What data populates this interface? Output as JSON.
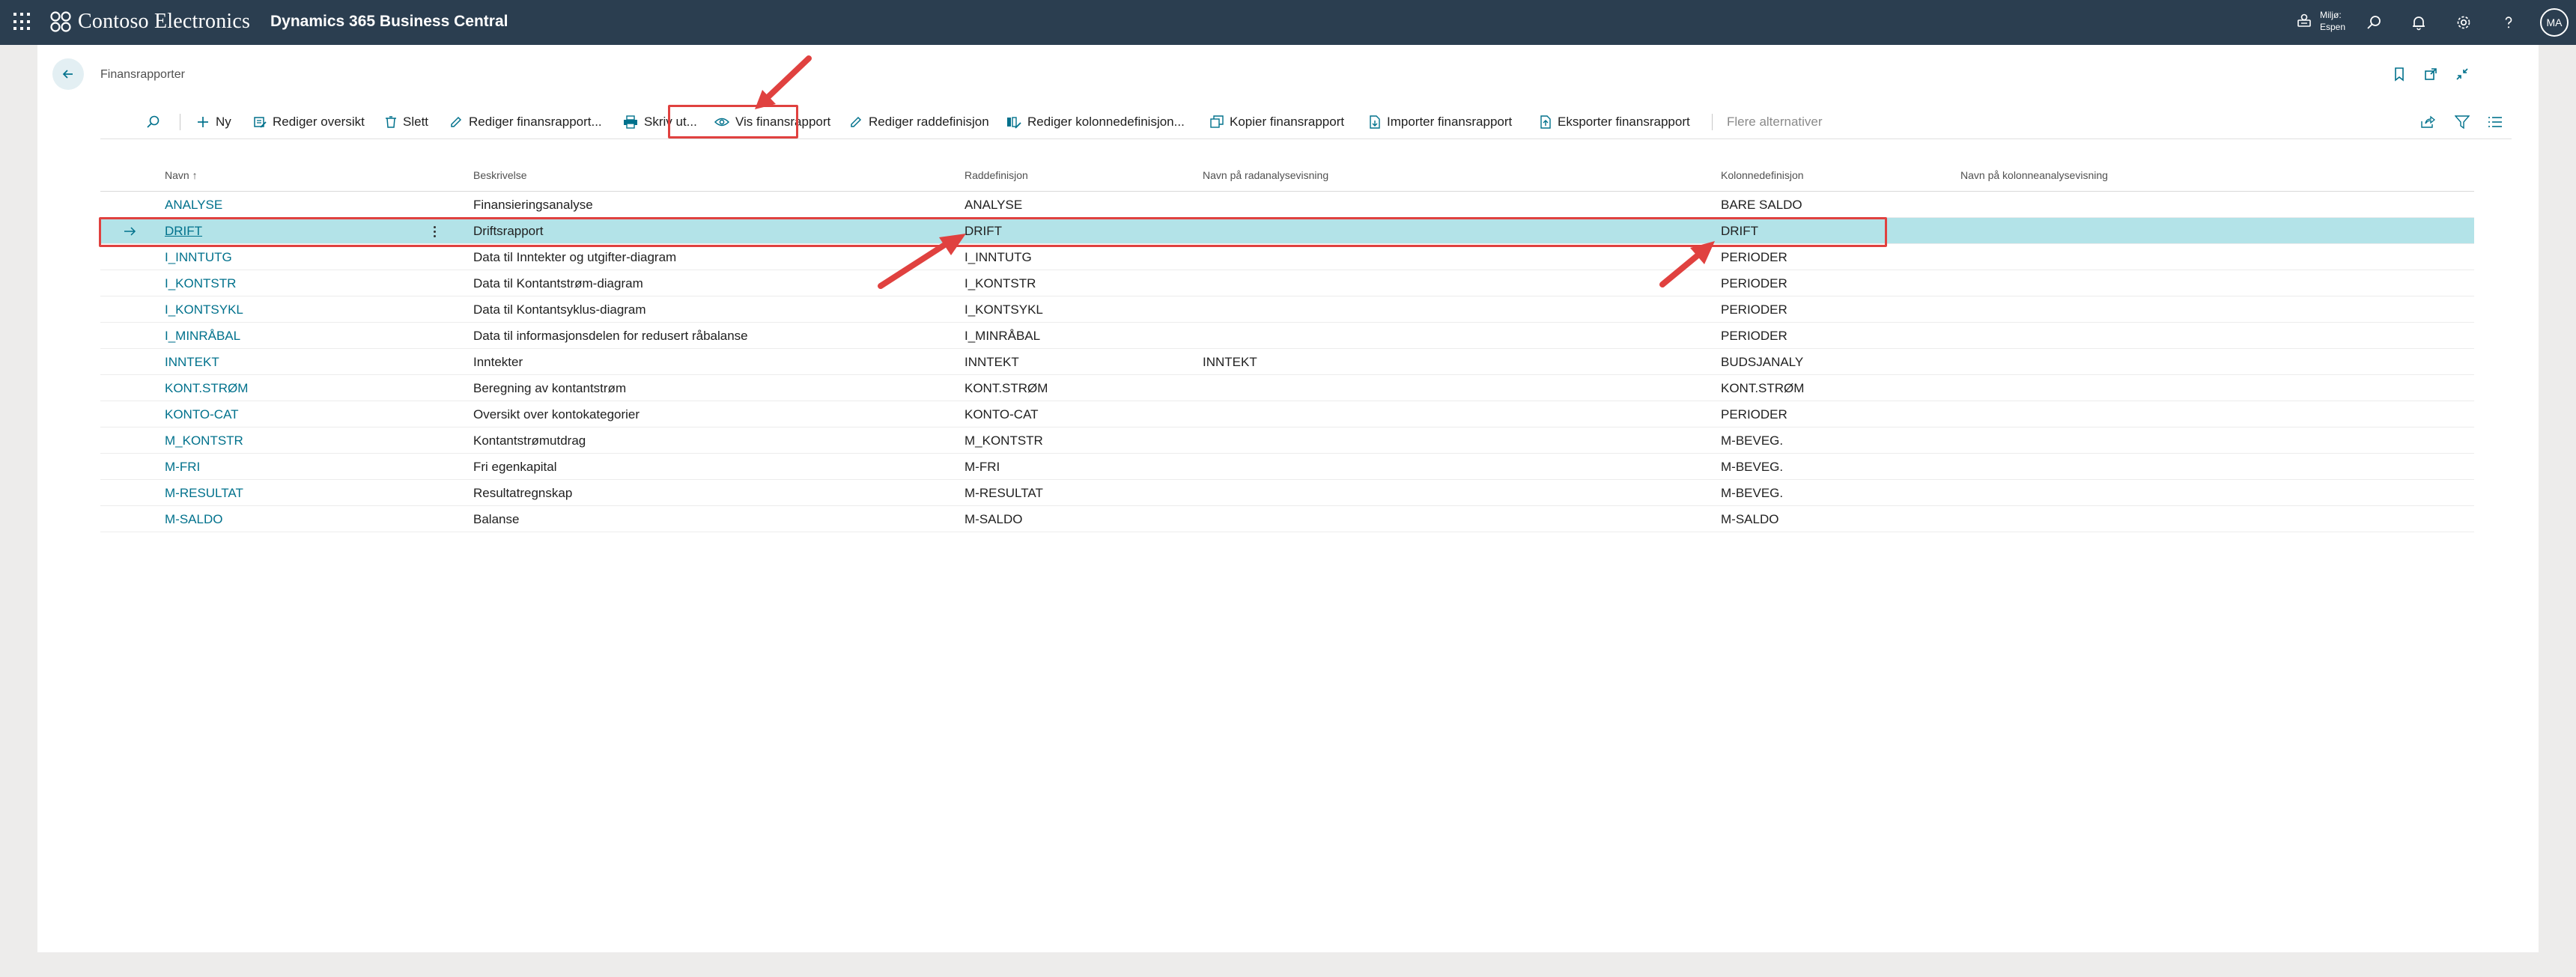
{
  "appbar": {
    "brand": "Contoso Electronics",
    "product": "Dynamics 365 Business Central",
    "environment_label": "Miljø:",
    "environment_name": "Espen",
    "avatar_initials": "MA"
  },
  "page": {
    "title": "Finansrapporter"
  },
  "actions": {
    "new": "Ny",
    "edit_list": "Rediger oversikt",
    "delete": "Slett",
    "edit_report": "Rediger finansrapport...",
    "print": "Skriv ut...",
    "view_report": "Vis finansrapport",
    "edit_row_def": "Rediger raddefinisjon",
    "edit_col_def": "Rediger kolonnedefinisjon...",
    "copy_report": "Kopier finansrapport",
    "import_report": "Importer finansrapport",
    "export_report": "Eksporter finansrapport",
    "more": "Flere alternativer"
  },
  "columns": {
    "name": "Navn",
    "description": "Beskrivelse",
    "row_def": "Raddefinisjon",
    "row_analysis_view": "Navn på radanalysevisning",
    "col_def": "Kolonnedefinisjon",
    "col_analysis_view": "Navn på kolonneanalysevisning"
  },
  "rows": [
    {
      "name": "ANALYSE",
      "description": "Finansieringsanalyse",
      "row_def": "ANALYSE",
      "row_view": "",
      "col_def": "BARE SALDO",
      "col_view": ""
    },
    {
      "name": "DRIFT",
      "description": "Driftsrapport",
      "row_def": "DRIFT",
      "row_view": "",
      "col_def": "DRIFT",
      "col_view": ""
    },
    {
      "name": "I_INNTUTG",
      "description": "Data til Inntekter og utgifter-diagram",
      "row_def": "I_INNTUTG",
      "row_view": "",
      "col_def": "PERIODER",
      "col_view": ""
    },
    {
      "name": "I_KONTSTR",
      "description": "Data til Kontantstrøm-diagram",
      "row_def": "I_KONTSTR",
      "row_view": "",
      "col_def": "PERIODER",
      "col_view": ""
    },
    {
      "name": "I_KONTSYKL",
      "description": "Data til Kontantsyklus-diagram",
      "row_def": "I_KONTSYKL",
      "row_view": "",
      "col_def": "PERIODER",
      "col_view": ""
    },
    {
      "name": "I_MINRÅBAL",
      "description": "Data til informasjonsdelen for redusert råbalanse",
      "row_def": "I_MINRÅBAL",
      "row_view": "",
      "col_def": "PERIODER",
      "col_view": ""
    },
    {
      "name": "INNTEKT",
      "description": "Inntekter",
      "row_def": "INNTEKT",
      "row_view": "INNTEKT",
      "col_def": "BUDSJANALY",
      "col_view": ""
    },
    {
      "name": "KONT.STRØM",
      "description": "Beregning av kontantstrøm",
      "row_def": "KONT.STRØM",
      "row_view": "",
      "col_def": "KONT.STRØM",
      "col_view": ""
    },
    {
      "name": "KONTO-CAT",
      "description": "Oversikt over kontokategorier",
      "row_def": "KONTO-CAT",
      "row_view": "",
      "col_def": "PERIODER",
      "col_view": ""
    },
    {
      "name": "M_KONTSTR",
      "description": "Kontantstrømutdrag",
      "row_def": "M_KONTSTR",
      "row_view": "",
      "col_def": "M-BEVEG.",
      "col_view": ""
    },
    {
      "name": "M-FRI",
      "description": "Fri egenkapital",
      "row_def": "M-FRI",
      "row_view": "",
      "col_def": "M-BEVEG.",
      "col_view": ""
    },
    {
      "name": "M-RESULTAT",
      "description": "Resultatregnskap",
      "row_def": "M-RESULTAT",
      "row_view": "",
      "col_def": "M-BEVEG.",
      "col_view": ""
    },
    {
      "name": "M-SALDO",
      "description": "Balanse",
      "row_def": "M-SALDO",
      "row_view": "",
      "col_def": "M-SALDO",
      "col_view": ""
    }
  ],
  "selected_row": 1,
  "colors": {
    "appbar": "#2b3e50",
    "accent": "#00718c",
    "selected_row": "#b3e3e8",
    "annotation": "#e0413f"
  },
  "icons": [
    "waffle-icon",
    "contoso-logo-icon",
    "environment-icon",
    "search-icon",
    "bell-icon",
    "gear-icon",
    "help-icon",
    "back-arrow-icon",
    "bookmark-icon",
    "open-new-window-icon",
    "collapse-icon",
    "plus-icon",
    "edit-list-icon",
    "trash-icon",
    "pencil-icon",
    "printer-icon",
    "eye-icon",
    "copy-icon",
    "import-icon",
    "export-icon",
    "share-icon",
    "filter-icon",
    "list-view-icon",
    "row-arrow-icon",
    "row-menu-icon"
  ]
}
